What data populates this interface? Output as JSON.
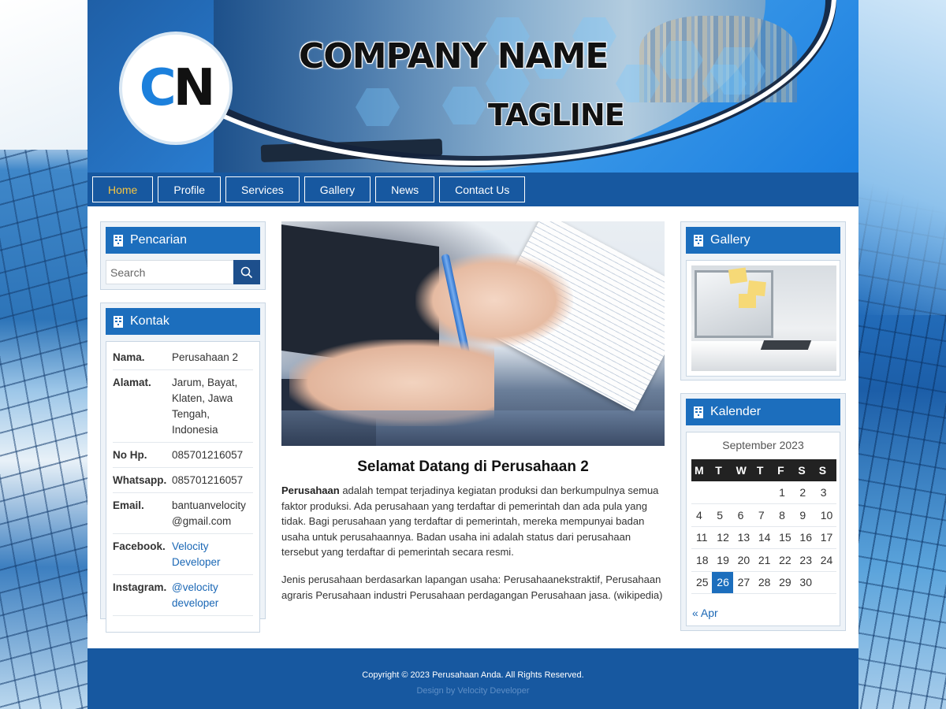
{
  "header": {
    "logo_c": "C",
    "logo_n": "N",
    "company_name": "COMPANY NAME",
    "tagline": "TAGLINE"
  },
  "nav": {
    "items": [
      "Home",
      "Profile",
      "Services",
      "Gallery",
      "News",
      "Contact Us"
    ],
    "active": "Home"
  },
  "search_widget": {
    "title": "Pencarian",
    "placeholder": "Search",
    "icon": "search-icon"
  },
  "contact_widget": {
    "title": "Kontak",
    "rows": [
      {
        "key": "Nama.",
        "value": "Perusahaan 2"
      },
      {
        "key": "Alamat.",
        "value": "Jarum, Bayat, Klaten, Jawa Tengah, Indonesia"
      },
      {
        "key": "No Hp.",
        "value": "085701216057"
      },
      {
        "key": "Whatsapp.",
        "value": "085701216057"
      },
      {
        "key": "Email.",
        "value": "bantuanvelocity @gmail.com"
      },
      {
        "key": "Facebook.",
        "value": "Velocity Developer"
      },
      {
        "key": "Instagram.",
        "value": "@velocity developer"
      }
    ]
  },
  "main": {
    "title": "Selamat Datang di Perusahaan 2",
    "p1_bold": "Perusahaan",
    "p1_text": " adalah tempat terjadinya kegiatan produksi dan berkumpulnya semua faktor produksi. Ada perusahaan yang terdaftar di pemerintah dan ada pula yang tidak. Bagi perusahaan yang terdaftar di pemerintah, mereka mempunyai badan usaha untuk perusahaannya. Badan usaha ini adalah status dari perusahaan tersebut yang terdaftar di pemerintah secara resmi.",
    "p2_text": "Jenis perusahaan berdasarkan lapangan usaha: Perusahaanekstraktif, Perusahaan agraris Perusahaan industri Perusahaan perdagangan Perusahaan jasa. (wikipedia)"
  },
  "gallery_widget": {
    "title": "Gallery"
  },
  "calendar_widget": {
    "title": "Kalender",
    "caption": "September 2023",
    "days": [
      "M",
      "T",
      "W",
      "T",
      "F",
      "S",
      "S"
    ],
    "weeks": [
      [
        "",
        "",
        "",
        "",
        "1",
        "2",
        "3"
      ],
      [
        "4",
        "5",
        "6",
        "7",
        "8",
        "9",
        "10"
      ],
      [
        "11",
        "12",
        "13",
        "14",
        "15",
        "16",
        "17"
      ],
      [
        "18",
        "19",
        "20",
        "21",
        "22",
        "23",
        "24"
      ],
      [
        "25",
        "26",
        "27",
        "28",
        "29",
        "30",
        ""
      ]
    ],
    "today": "26",
    "prev_link": "« Apr"
  },
  "footer": {
    "copyright": "Copyright © 2023 Perusahaan Anda. All Rights Reserved.",
    "design": "Design by Velocity Developer"
  },
  "colors": {
    "primary": "#1758a0",
    "widget_head": "#1c6ebd",
    "active_nav": "#f5c542",
    "link": "#1a67b5"
  }
}
